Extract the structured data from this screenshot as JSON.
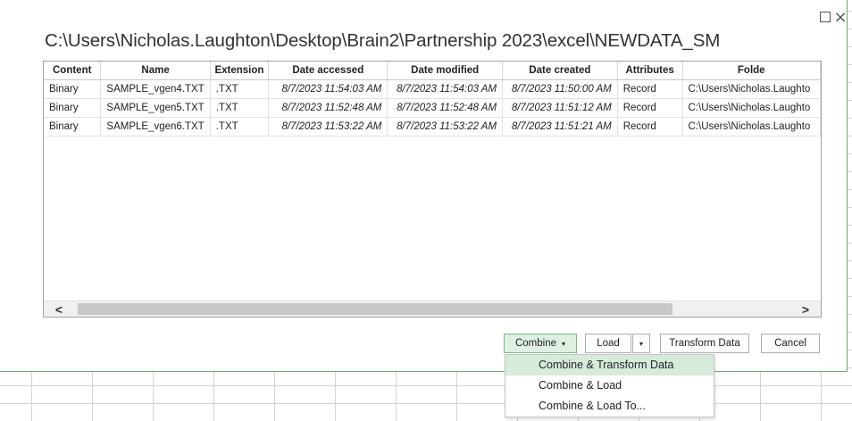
{
  "title_path": "C:\\Users\\Nicholas.Laughton\\Desktop\\Brain2\\Partnership 2023\\excel\\NEWDATA_SM",
  "window_controls": {
    "maximize_icon": "maximize-icon",
    "close_glyph": "×"
  },
  "table": {
    "columns": [
      "Content",
      "Name",
      "Extension",
      "Date accessed",
      "Date modified",
      "Date created",
      "Attributes",
      "Folde"
    ],
    "rows": [
      [
        "Binary",
        "SAMPLE_vgen4.TXT",
        ".TXT",
        "8/7/2023 11:54:03 AM",
        "8/7/2023 11:54:03 AM",
        "8/7/2023 11:50:00 AM",
        "Record",
        "C:\\Users\\Nicholas.Laughto"
      ],
      [
        "Binary",
        "SAMPLE_vgen5.TXT",
        ".TXT",
        "8/7/2023 11:52:48 AM",
        "8/7/2023 11:52:48 AM",
        "8/7/2023 11:51:12 AM",
        "Record",
        "C:\\Users\\Nicholas.Laughto"
      ],
      [
        "Binary",
        "SAMPLE_vgen6.TXT",
        ".TXT",
        "8/7/2023 11:53:22 AM",
        "8/7/2023 11:53:22 AM",
        "8/7/2023 11:51:21 AM",
        "Record",
        "C:\\Users\\Nicholas.Laughto"
      ]
    ]
  },
  "scrollbar": {
    "left_glyph": "<",
    "right_glyph": ">"
  },
  "buttons": {
    "combine": "Combine",
    "combine_caret": "▾",
    "load": "Load",
    "load_caret": "▾",
    "transform": "Transform Data",
    "cancel": "Cancel"
  },
  "combine_menu": [
    "Combine & Transform Data",
    "Combine & Load",
    "Combine & Load To..."
  ],
  "colors": {
    "accent_green": "#dff0e3",
    "menu_highlight": "#d7ebdc",
    "frame_border": "#6aa87a"
  }
}
